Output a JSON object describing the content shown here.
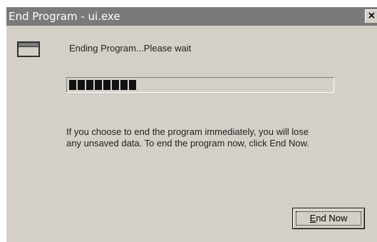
{
  "window": {
    "title": "End Program - ui.exe",
    "close_glyph": "×"
  },
  "icons": {
    "app": "application-window-icon",
    "close": "close-icon"
  },
  "status": {
    "text": "Ending Program...Please wait"
  },
  "progress": {
    "filled_segments": 8,
    "fraction": 0.24
  },
  "message": {
    "line1": "If you choose to end the program immediately, you will lose",
    "line2": "any unsaved data. To end the program now, click End Now."
  },
  "button": {
    "mnemonic": "E",
    "label_rest": "nd Now"
  },
  "colors": {
    "face": "#d4d0c8",
    "titlebar": "#7a7a7a",
    "progress_fill": "#111111"
  }
}
